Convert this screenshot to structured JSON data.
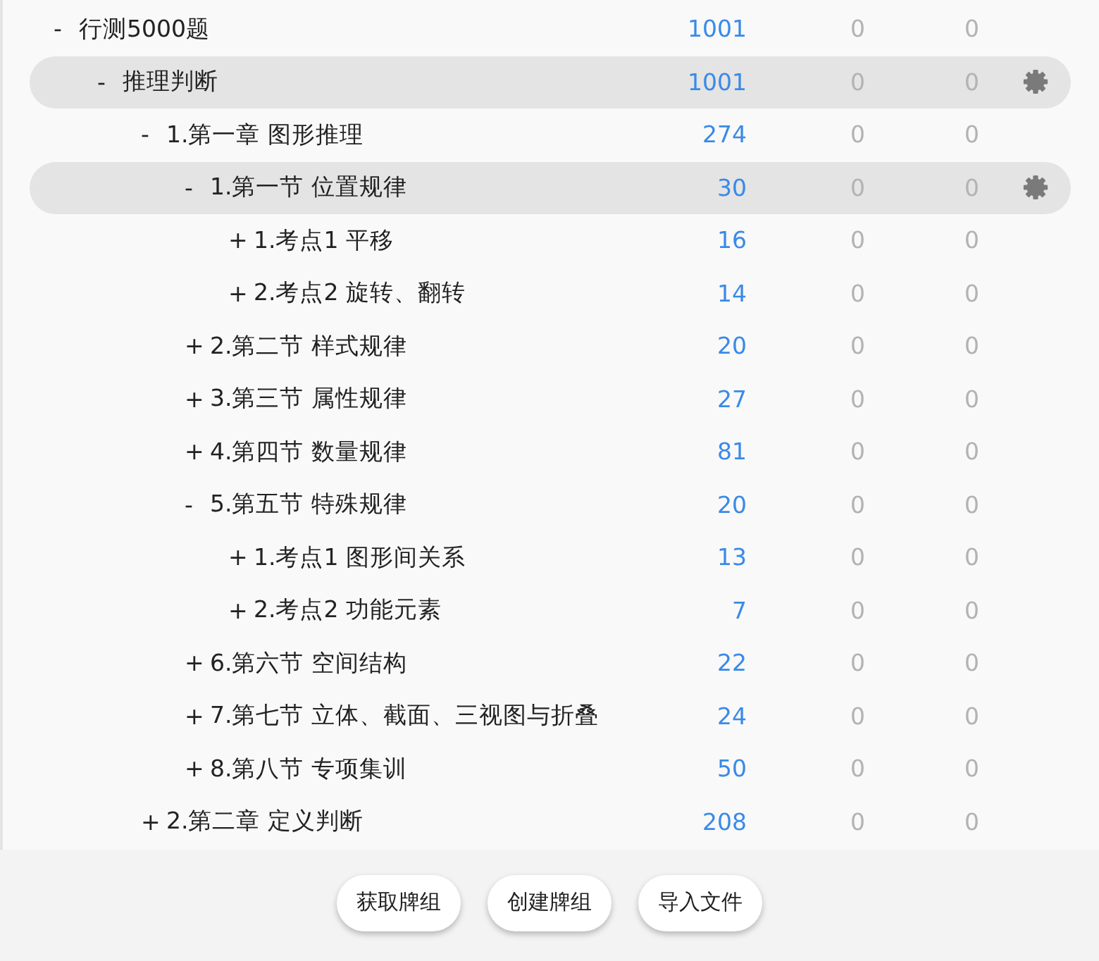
{
  "tree": [
    {
      "toggle": "-",
      "label": "行测5000题",
      "count": "1001",
      "column_3": "0",
      "column_4": "0",
      "selected": false,
      "children": [
        {
          "toggle": "-",
          "label": "推理判断",
          "count": "1001",
          "column_3": "0",
          "column_4": "0",
          "selected": true,
          "children": [
            {
              "toggle": "-",
              "label": "1.第一章 图形推理",
              "count": "274",
              "column_3": "0",
              "column_4": "0",
              "selected": false,
              "children": [
                {
                  "toggle": "-",
                  "label": "1.第一节 位置规律",
                  "count": "30",
                  "column_3": "0",
                  "column_4": "0",
                  "selected": true,
                  "children": [
                    {
                      "toggle": "+",
                      "label": "1.考点1 平移",
                      "count": "16",
                      "column_3": "0",
                      "column_4": "0",
                      "selected": false
                    },
                    {
                      "toggle": "+",
                      "label": "2.考点2 旋转、翻转",
                      "count": "14",
                      "column_3": "0",
                      "column_4": "0",
                      "selected": false
                    }
                  ]
                },
                {
                  "toggle": "+",
                  "label": "2.第二节 样式规律",
                  "count": "20",
                  "column_3": "0",
                  "column_4": "0",
                  "selected": false
                },
                {
                  "toggle": "+",
                  "label": "3.第三节 属性规律",
                  "count": "27",
                  "column_3": "0",
                  "column_4": "0",
                  "selected": false
                },
                {
                  "toggle": "+",
                  "label": "4.第四节 数量规律",
                  "count": "81",
                  "column_3": "0",
                  "column_4": "0",
                  "selected": false
                },
                {
                  "toggle": "-",
                  "label": "5.第五节 特殊规律",
                  "count": "20",
                  "column_3": "0",
                  "column_4": "0",
                  "selected": false,
                  "children": [
                    {
                      "toggle": "+",
                      "label": "1.考点1 图形间关系",
                      "count": "13",
                      "column_3": "0",
                      "column_4": "0",
                      "selected": false
                    },
                    {
                      "toggle": "+",
                      "label": "2.考点2 功能元素",
                      "count": "7",
                      "column_3": "0",
                      "column_4": "0",
                      "selected": false
                    }
                  ]
                },
                {
                  "toggle": "+",
                  "label": "6.第六节 空间结构",
                  "count": "22",
                  "column_3": "0",
                  "column_4": "0",
                  "selected": false
                },
                {
                  "toggle": "+",
                  "label": "7.第七节 立体、截面、三视图与折叠",
                  "count": "24",
                  "column_3": "0",
                  "column_4": "0",
                  "selected": false
                },
                {
                  "toggle": "+",
                  "label": "8.第八节 专项集训",
                  "count": "50",
                  "column_3": "0",
                  "column_4": "0",
                  "selected": false
                }
              ]
            },
            {
              "toggle": "+",
              "label": "2.第二章 定义判断",
              "count": "208",
              "column_3": "0",
              "column_4": "0",
              "selected": false
            }
          ]
        }
      ]
    }
  ],
  "buttons": [
    "获取牌组",
    "创建牌组",
    "导入文件"
  ]
}
